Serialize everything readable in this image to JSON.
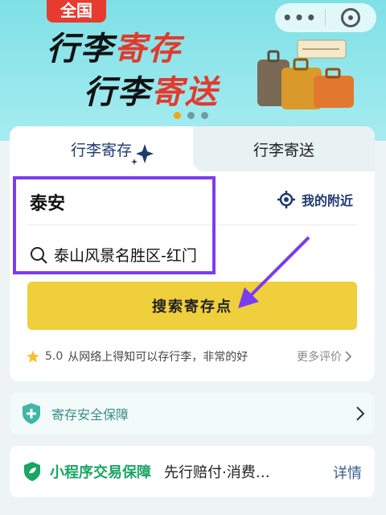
{
  "banner": {
    "badge": "全国",
    "title1_black": "行李",
    "title1_red": "寄存",
    "title2_black": "行李",
    "title2_red": "寄送",
    "more_label": "•••"
  },
  "tabs": {
    "storage": "行李寄存",
    "delivery": "行李寄送"
  },
  "search": {
    "city": "泰安",
    "nearby": "我的附近",
    "location": "泰山风景名胜区-红门",
    "button": "搜索寄存点"
  },
  "rating": {
    "score": "5.0",
    "comment": "从网络上得知可以存行李，非常的好",
    "more": "更多评价"
  },
  "safety": {
    "label": "寄存安全保障"
  },
  "guarantee": {
    "title": "小程序交易保障",
    "desc": "先行赔付·消费…",
    "detail": "详情"
  },
  "colors": {
    "accent_purple": "#7a3df0",
    "button_yellow": "#f0cf3c",
    "brand_navy": "#1e3a6e",
    "badge_red": "#e63b2e",
    "guarantee_green": "#1aa564"
  },
  "icons": [
    "more-dots-icon",
    "close-miniprogram-icon",
    "sparkle-icon",
    "locate-icon",
    "search-icon",
    "star-icon",
    "chevron-right-icon",
    "shield-plus-icon",
    "leaf-shield-icon"
  ]
}
